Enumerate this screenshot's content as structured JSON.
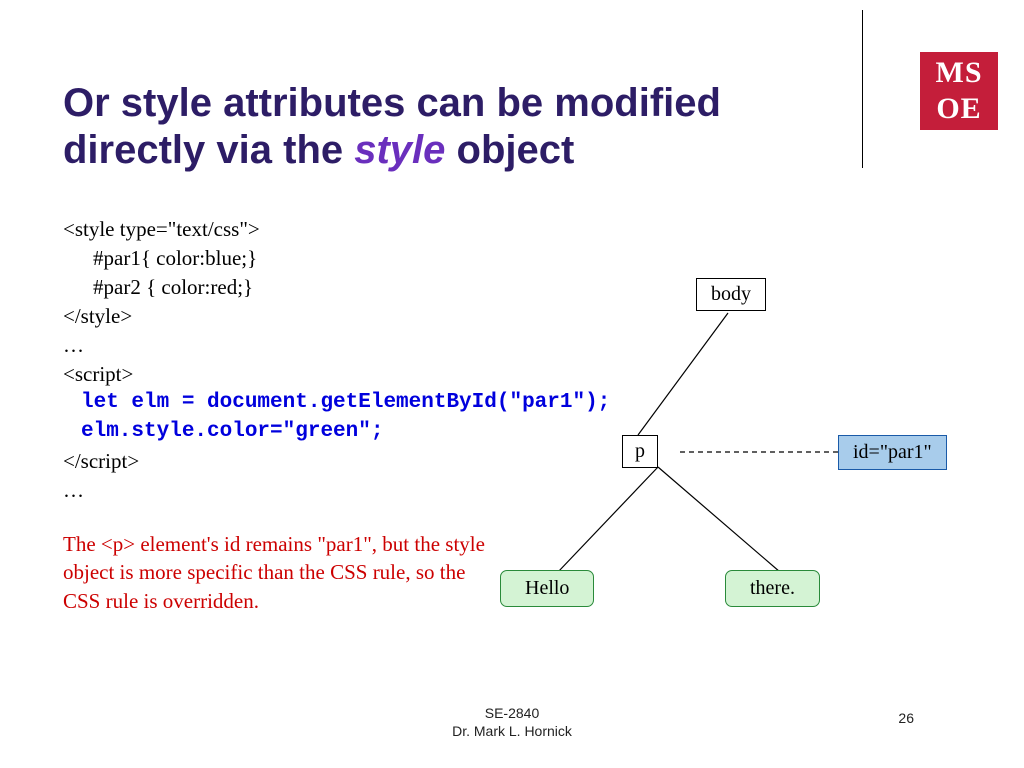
{
  "logo": {
    "line1": "MS",
    "line2": "OE"
  },
  "title": {
    "part1": "Or style attributes can be modified directly via the ",
    "em": "style",
    "part2": " object"
  },
  "code": {
    "l1": "<style type=\"text/css\">",
    "l2": "#par1{ color:blue;}",
    "l3": "#par2 { color:red;}",
    "l4": "</style>",
    "l5": "…",
    "l6": "<script>",
    "l7": "let elm = document.getElementById(\"par1\");",
    "l8": "elm.style.color=\"green\";",
    "l9": "</script>",
    "l10": "…"
  },
  "note": "The <p> element's id remains \"par1\", but the style object is more specific than the CSS rule, so the CSS rule is overridden.",
  "diagram": {
    "body": "body",
    "p": "p",
    "attr": "id=\"par1\"",
    "leaf1": "Hello",
    "leaf2": "there."
  },
  "footer": {
    "course": "SE-2840",
    "author": "Dr. Mark L. Hornick"
  },
  "page": "26"
}
